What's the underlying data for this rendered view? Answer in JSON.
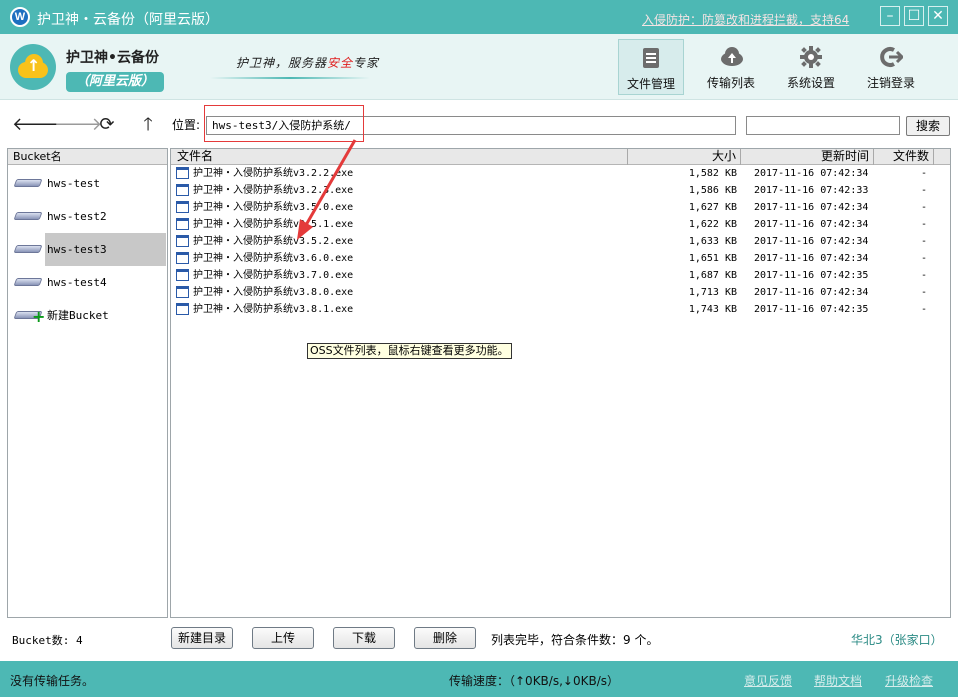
{
  "window": {
    "title": "护卫神・云备份（阿里云版）",
    "promo_link": "入侵防护：防篡改和进程拦截，支持64",
    "logo_letter": "W"
  },
  "header": {
    "brand_name": "护卫神•云备份",
    "brand_sub": "（阿里云版）",
    "slogan_pre": "护卫神，服务器",
    "slogan_red": "安全",
    "slogan_post": "专家",
    "nav": [
      {
        "label": "文件管理",
        "icon": "document-icon",
        "active": true
      },
      {
        "label": "传输列表",
        "icon": "cloud-upload-icon",
        "active": false
      },
      {
        "label": "系统设置",
        "icon": "gear-icon",
        "active": false
      },
      {
        "label": "注销登录",
        "icon": "logout-icon",
        "active": false
      }
    ]
  },
  "toolbar": {
    "location_label": "位置:",
    "location_value": "hws-test3/入侵防护系统/",
    "search_placeholder": "",
    "search_button": "搜索"
  },
  "buckets": {
    "header": "Bucket名",
    "items": [
      {
        "label": "hws-test",
        "selected": false
      },
      {
        "label": "hws-test2",
        "selected": false
      },
      {
        "label": "hws-test3",
        "selected": true
      },
      {
        "label": "hws-test4",
        "selected": false
      },
      {
        "label": "新建Bucket",
        "selected": false,
        "add": true
      }
    ],
    "count_label": "Bucket数: 4"
  },
  "files": {
    "columns": {
      "name": "文件名",
      "size": "大小",
      "time": "更新时间",
      "count": "文件数"
    },
    "rows": [
      {
        "name": "护卫神・入侵防护系统v3.2.2.exe",
        "size": "1,582 KB",
        "time": "2017-11-16 07:42:34",
        "count": "-"
      },
      {
        "name": "护卫神・入侵防护系统v3.2.3.exe",
        "size": "1,586 KB",
        "time": "2017-11-16 07:42:33",
        "count": "-"
      },
      {
        "name": "护卫神・入侵防护系统v3.5.0.exe",
        "size": "1,627 KB",
        "time": "2017-11-16 07:42:34",
        "count": "-"
      },
      {
        "name": "护卫神・入侵防护系统v3.5.1.exe",
        "size": "1,622 KB",
        "time": "2017-11-16 07:42:34",
        "count": "-"
      },
      {
        "name": "护卫神・入侵防护系统v3.5.2.exe",
        "size": "1,633 KB",
        "time": "2017-11-16 07:42:34",
        "count": "-"
      },
      {
        "name": "护卫神・入侵防护系统v3.6.0.exe",
        "size": "1,651 KB",
        "time": "2017-11-16 07:42:34",
        "count": "-"
      },
      {
        "name": "护卫神・入侵防护系统v3.7.0.exe",
        "size": "1,687 KB",
        "time": "2017-11-16 07:42:35",
        "count": "-"
      },
      {
        "name": "护卫神・入侵防护系统v3.8.0.exe",
        "size": "1,713 KB",
        "time": "2017-11-16 07:42:34",
        "count": "-"
      },
      {
        "name": "护卫神・入侵防护系统v3.8.1.exe",
        "size": "1,743 KB",
        "time": "2017-11-16 07:42:35",
        "count": "-"
      }
    ],
    "tooltip": "OSS文件列表，鼠标右键查看更多功能。"
  },
  "actions": {
    "new_dir": "新建目录",
    "upload": "上传",
    "download": "下载",
    "delete": "删除",
    "status": "列表完毕，符合条件数：9 个。",
    "region": "华北3（张家口）"
  },
  "statusbar": {
    "task": "没有传输任务。",
    "speed": "传输速度：（↑0KB/s,↓0KB/s）",
    "feedback": "意见反馈",
    "help": "帮助文档",
    "upgrade": "升级检查"
  },
  "colors": {
    "accent": "#4db8b4",
    "annotation": "#e43a3a",
    "logo_yellow": "#f8c21a"
  }
}
